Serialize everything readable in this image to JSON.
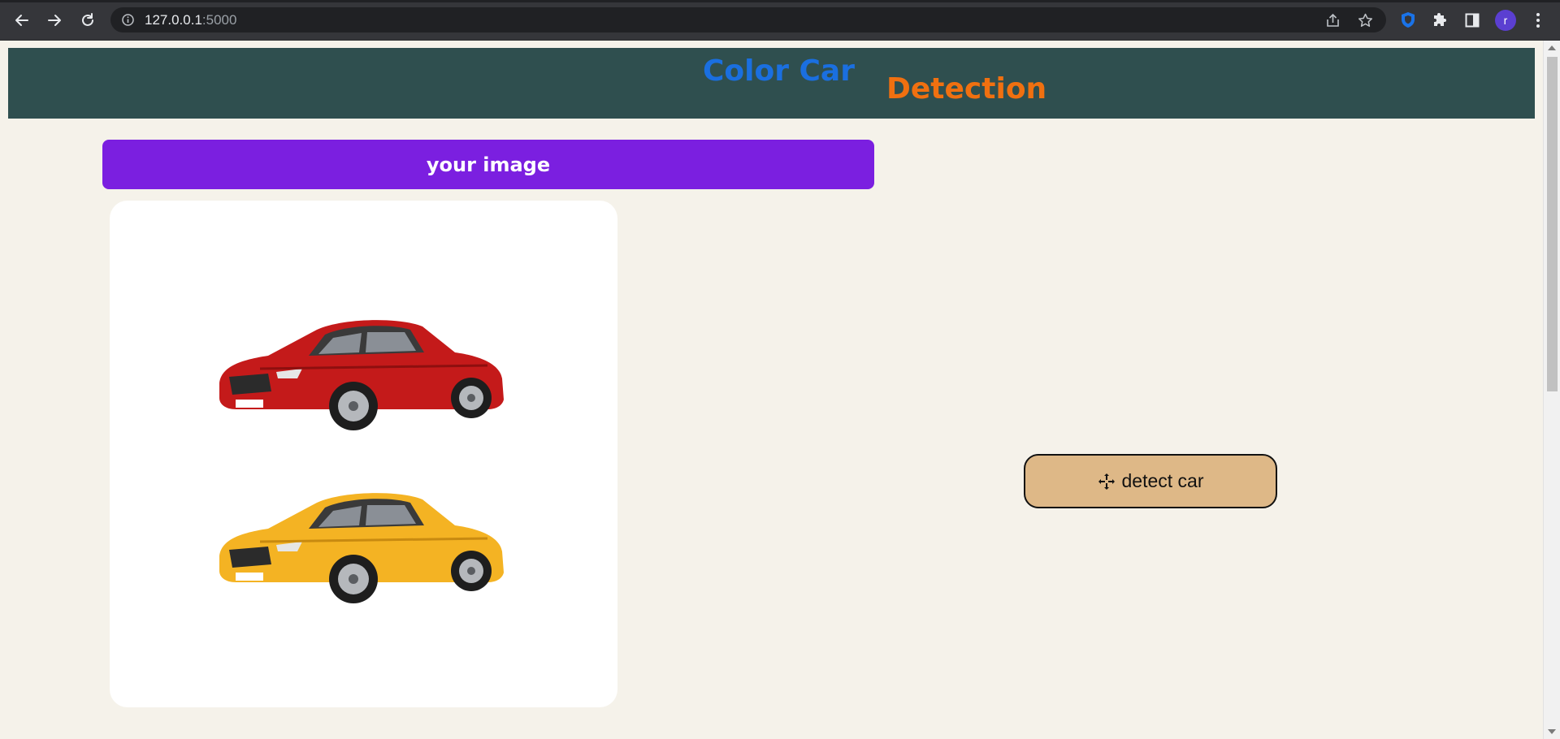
{
  "browser": {
    "url_host": "127.0.0.1",
    "url_port": ":5000",
    "profile_initial": "r"
  },
  "page": {
    "title_part1": "Color Car",
    "title_part2": "Detection",
    "image_bar_label": "your image",
    "detect_button_label": "detect car",
    "colors": {
      "header_bg": "#2f4f4f",
      "title_part1": "#1a6fe0",
      "title_part2": "#f07010",
      "image_bar_bg": "#7b1fe0",
      "detect_button_bg": "#deb887",
      "page_bg": "#f5f2ea"
    }
  }
}
